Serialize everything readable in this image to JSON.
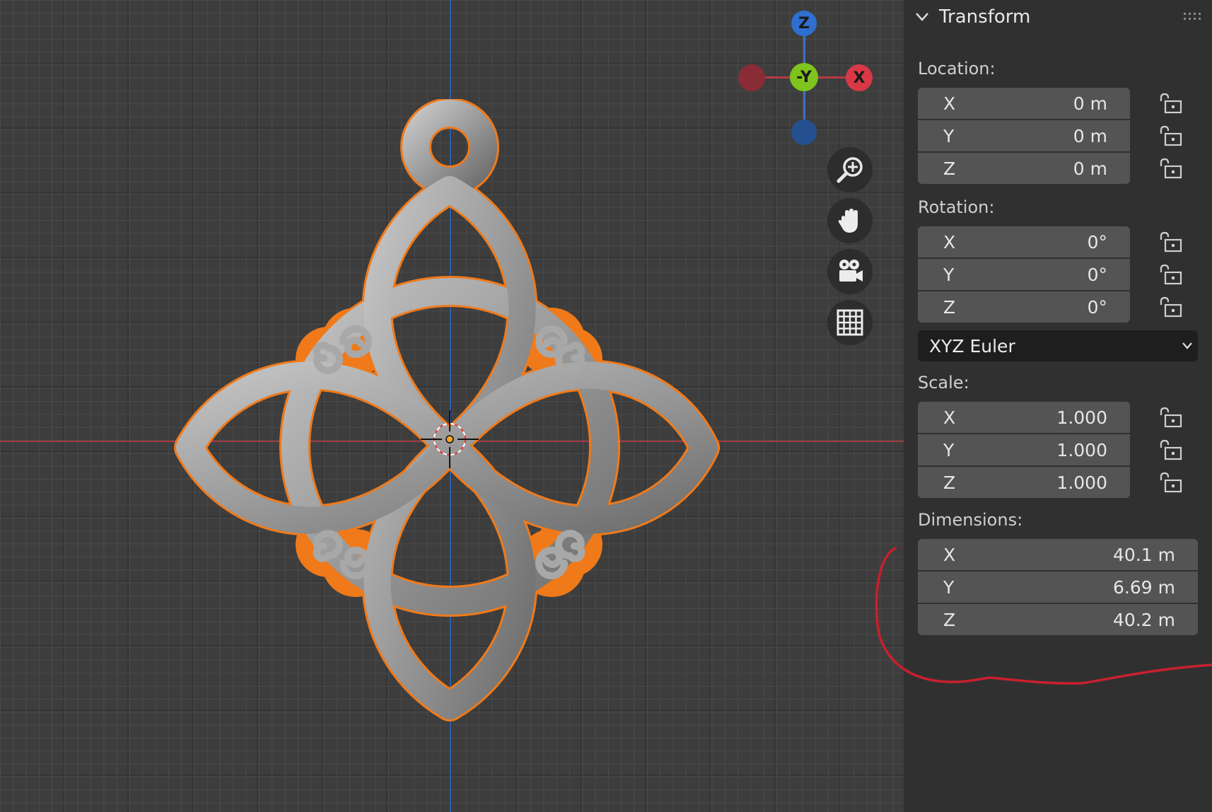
{
  "viewport": {
    "gizmo": {
      "z_label": "Z",
      "neg_y_label": "-Y",
      "x_label": "X",
      "colors": {
        "z": "#2f6fcf",
        "y": "#7ec41d",
        "x": "#d93847",
        "neg_x": "#8a2c36",
        "neg_z": "#25508f"
      }
    },
    "nav_icons": [
      "zoom-icon",
      "hand-icon",
      "camera-icon",
      "grid-icon"
    ],
    "selection_color": "#f07a1a"
  },
  "panel": {
    "title": "Transform",
    "location": {
      "label": "Location:",
      "x_label": "X",
      "x": "0 m",
      "y_label": "Y",
      "y": "0 m",
      "z_label": "Z",
      "z": "0 m"
    },
    "rotation": {
      "label": "Rotation:",
      "x_label": "X",
      "x": "0°",
      "y_label": "Y",
      "y": "0°",
      "z_label": "Z",
      "z": "0°",
      "mode": "XYZ Euler"
    },
    "scale": {
      "label": "Scale:",
      "x_label": "X",
      "x": "1.000",
      "y_label": "Y",
      "y": "1.000",
      "z_label": "Z",
      "z": "1.000"
    },
    "dimensions": {
      "label": "Dimensions:",
      "x_label": "X",
      "x": "40.1 m",
      "y_label": "Y",
      "y": "6.69 m",
      "z_label": "Z",
      "z": "40.2 m"
    }
  },
  "annotation_color": "#c8202e"
}
